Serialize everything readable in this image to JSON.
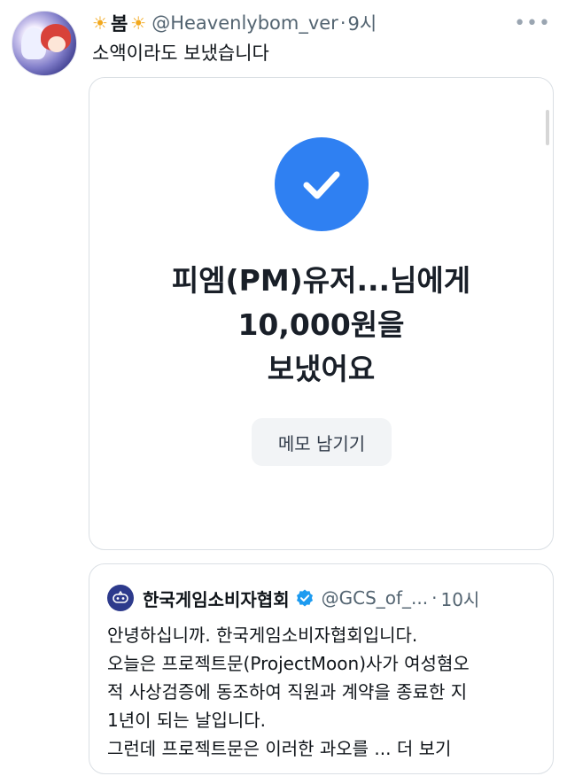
{
  "tweet": {
    "display_name": "봄",
    "name_emoji": "☀",
    "handle": "@Heavenlybom_ver",
    "separator": "·",
    "time": "9시",
    "text": "소액이라도 보냈습니다"
  },
  "card": {
    "title_lines": [
      "피엠(PM)유저...님에게",
      "10,000원을",
      "보냈어요"
    ],
    "memo_button_label": "메모 남기기"
  },
  "quote": {
    "name": "한국게임소비자협회",
    "handle": "@GCS_of_...",
    "separator": "·",
    "time": "10시",
    "lines": [
      "안녕하십니까. 한국게임소비자협회입니다.",
      "오늘은 프로젝트문(ProjectMoon)사가 여성혐오",
      "적 사상검증에 동조하여 직원과 계약을 종료한 지",
      "1년이 되는 날입니다.",
      "그런데 프로젝트문은 이러한 과오를 ..."
    ],
    "see_more": "더 보기"
  },
  "colors": {
    "accent_blue": "#2f80f2",
    "verified_blue": "#1d9bf0",
    "secondary_text": "#536471"
  }
}
